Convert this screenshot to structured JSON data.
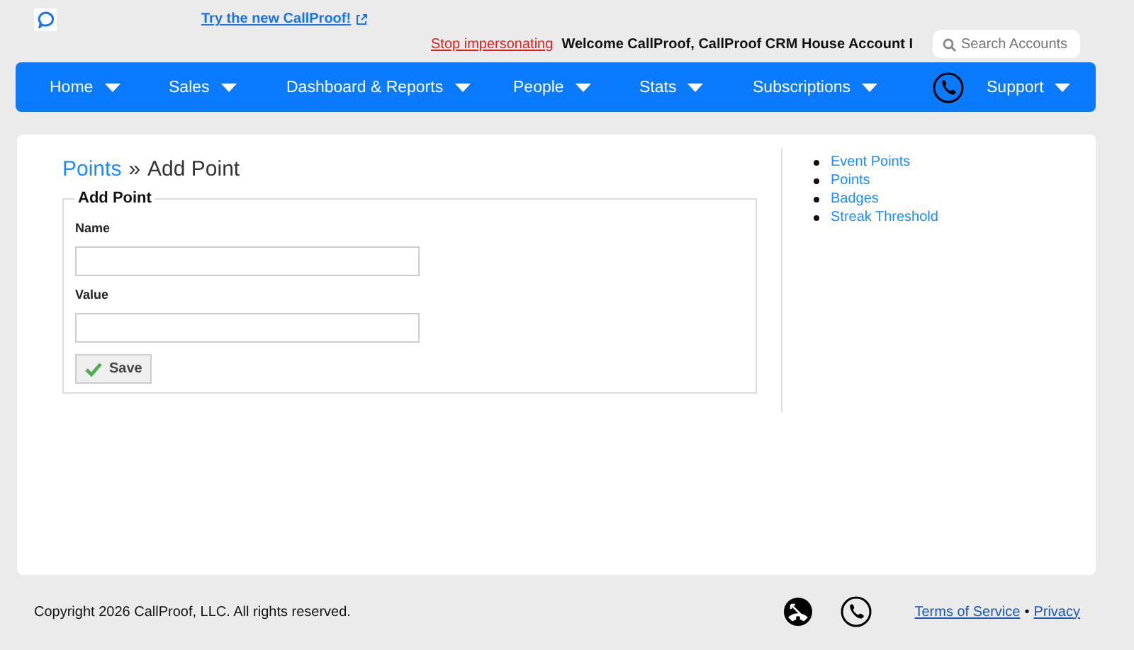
{
  "header": {
    "try_link": "Try the new CallProof!",
    "stop_link": "Stop impersonating",
    "welcome": "Welcome CallProof, CallProof CRM House Account I",
    "search": {
      "placeholder": "Search Accounts"
    }
  },
  "nav": [
    {
      "label": "Home",
      "kind": "menu"
    },
    {
      "label": "Sales",
      "kind": "menu"
    },
    {
      "label": "Dashboard & Reports",
      "kind": "menu"
    },
    {
      "label": "People",
      "kind": "menu"
    },
    {
      "label": "Stats",
      "kind": "menu"
    },
    {
      "label": "Subscriptions",
      "kind": "menu"
    },
    {
      "kind": "phone"
    },
    {
      "label": "Support",
      "kind": "menu"
    }
  ],
  "breadcrumb": {
    "link": "Points",
    "separator": "»",
    "current": "Add Point"
  },
  "form": {
    "legend": "Add Point",
    "fields": [
      {
        "label": "Name"
      },
      {
        "label": "Value"
      }
    ],
    "save": "Save"
  },
  "side_links": [
    "Event Points",
    "Points",
    "Badges",
    "Streak Threshold"
  ],
  "footer": {
    "copyright": "Copyright 2026 CallProof, LLC. All rights reserved.",
    "terms": "Terms of Service",
    "separator": "•",
    "privacy": "Privacy"
  }
}
